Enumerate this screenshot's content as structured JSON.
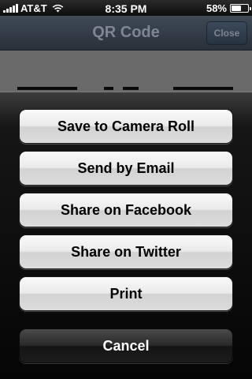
{
  "status_bar": {
    "carrier": "AT&T",
    "time": "8:35 PM",
    "battery": "58%",
    "battery_level": 0.58,
    "icons": [
      "signal-bars-icon",
      "wifi-icon",
      "battery-icon"
    ]
  },
  "nav_bar": {
    "title": "QR Code",
    "close_label": "Close"
  },
  "action_sheet": {
    "buttons": [
      {
        "label": "Save to Camera Roll",
        "style": "light"
      },
      {
        "label": "Send by Email",
        "style": "light"
      },
      {
        "label": "Share on Facebook",
        "style": "light"
      },
      {
        "label": "Share on Twitter",
        "style": "light"
      },
      {
        "label": "Print",
        "style": "light"
      }
    ],
    "cancel_label": "Cancel"
  },
  "colors": {
    "nav_bar": "#283039",
    "sheet_background": "#050505",
    "button_light": "#eaeaea",
    "button_dark": "#2a2a2a"
  }
}
